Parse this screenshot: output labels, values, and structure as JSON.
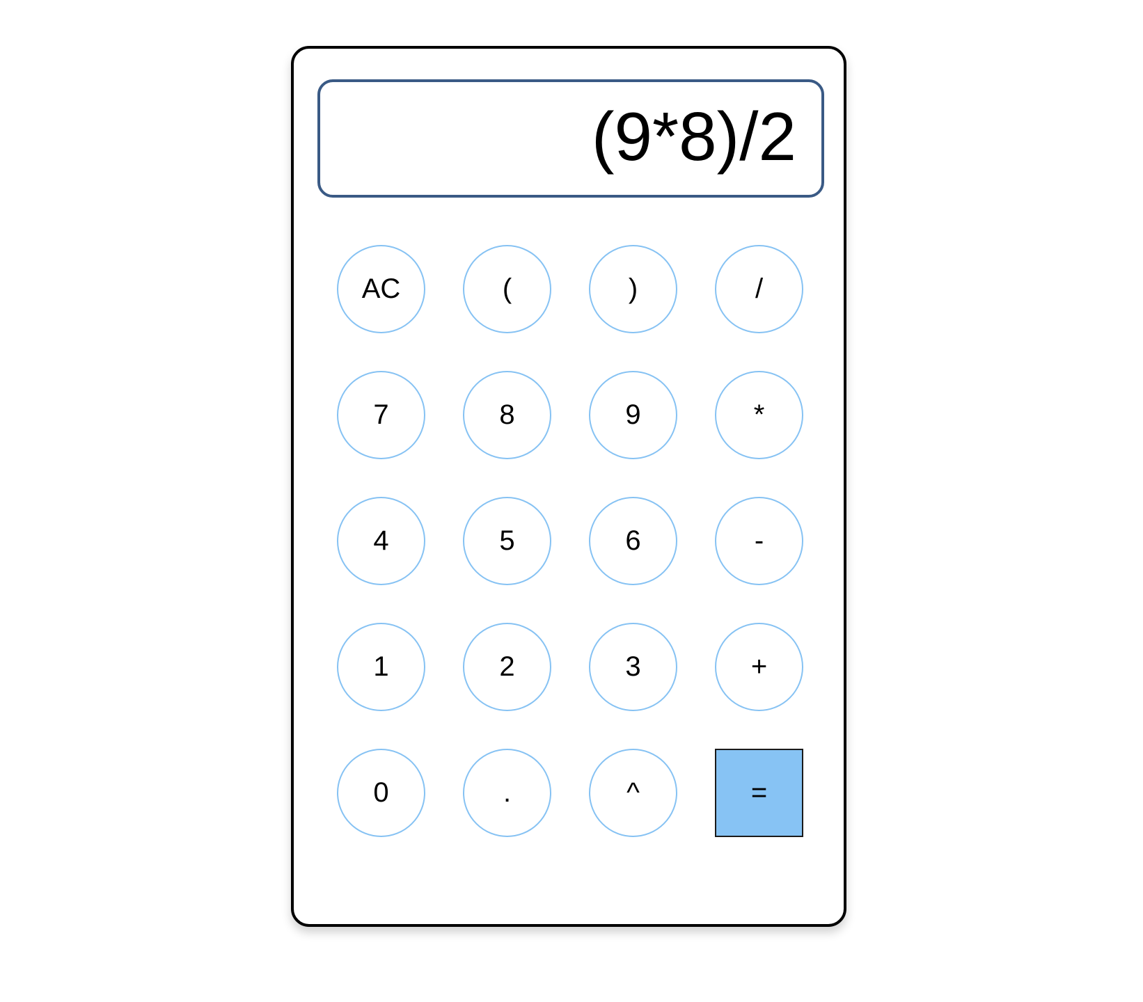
{
  "display": {
    "value": "(9*8)/2"
  },
  "keys": [
    {
      "label": "AC",
      "name": "clear-button"
    },
    {
      "label": "(",
      "name": "open-paren-button"
    },
    {
      "label": ")",
      "name": "close-paren-button"
    },
    {
      "label": "/",
      "name": "divide-button"
    },
    {
      "label": "7",
      "name": "digit-7-button"
    },
    {
      "label": "8",
      "name": "digit-8-button"
    },
    {
      "label": "9",
      "name": "digit-9-button"
    },
    {
      "label": "*",
      "name": "multiply-button"
    },
    {
      "label": "4",
      "name": "digit-4-button"
    },
    {
      "label": "5",
      "name": "digit-5-button"
    },
    {
      "label": "6",
      "name": "digit-6-button"
    },
    {
      "label": "-",
      "name": "subtract-button"
    },
    {
      "label": "1",
      "name": "digit-1-button"
    },
    {
      "label": "2",
      "name": "digit-2-button"
    },
    {
      "label": "3",
      "name": "digit-3-button"
    },
    {
      "label": "+",
      "name": "add-button"
    },
    {
      "label": "0",
      "name": "digit-0-button"
    },
    {
      "label": ".",
      "name": "decimal-button"
    },
    {
      "label": "^",
      "name": "power-button"
    },
    {
      "label": "=",
      "name": "equals-button"
    }
  ],
  "colors": {
    "key_border": "#86c2f3",
    "equals_fill": "#87c3f4",
    "display_border": "#3a5a85"
  }
}
